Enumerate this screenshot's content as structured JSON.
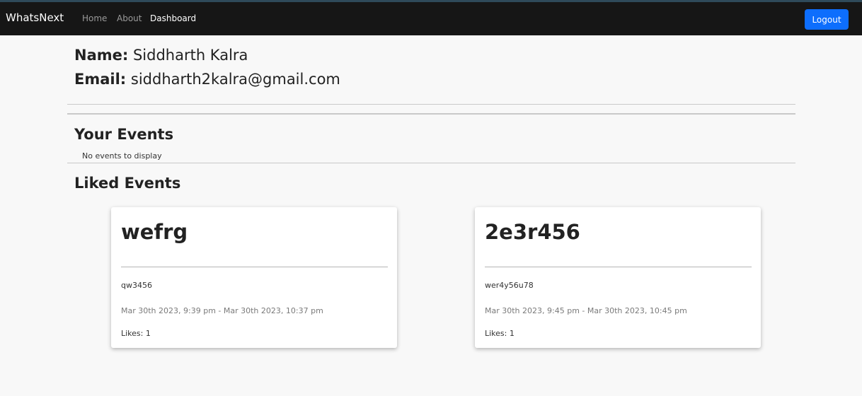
{
  "navbar": {
    "brand": "WhatsNext",
    "links": [
      {
        "label": "Home"
      },
      {
        "label": "About"
      },
      {
        "label": "Dashboard"
      }
    ],
    "logout_label": "Logout"
  },
  "profile": {
    "name_label": "Name:",
    "name_value": " Siddharth Kalra",
    "email_label": "Email:",
    "email_value": " siddharth2kalra@gmail.com"
  },
  "your_events": {
    "title": "Your Events",
    "empty_text": "No events to display"
  },
  "liked_events": {
    "title": "Liked Events",
    "cards": [
      {
        "title": "wefrg",
        "description": "qw3456",
        "dates": "Mar 30th 2023, 9:39 pm - Mar 30th 2023, 10:37 pm",
        "likes": "Likes: 1"
      },
      {
        "title": "2e3r456",
        "description": "wer4y56u78",
        "dates": "Mar 30th 2023, 9:45 pm - Mar 30th 2023, 10:45 pm",
        "likes": "Likes: 1"
      }
    ]
  },
  "colors": {
    "navbar_bg": "#161616",
    "accent": "#0d6efd",
    "page_bg": "#f8f8f8"
  }
}
